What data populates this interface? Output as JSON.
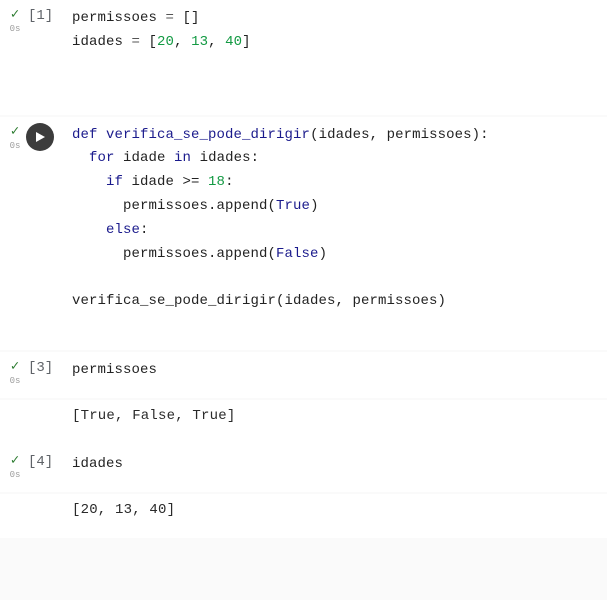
{
  "cells": [
    {
      "prompt": "[1]",
      "timing": "0s",
      "kind": "numbered",
      "lines": {
        "l0_a": "permissoes ",
        "l0_b": "=",
        "l0_c": " []",
        "l1_a": "idades ",
        "l1_b": "=",
        "l1_c": " [",
        "l1_n1": "20",
        "l1_s1": ", ",
        "l1_n2": "13",
        "l1_s2": ", ",
        "l1_n3": "40",
        "l1_d": "]"
      }
    },
    {
      "prompt": "",
      "timing": "0s",
      "kind": "run",
      "lines": {
        "l0_a": "def",
        "l0_sp": " ",
        "l0_b": "verifica_se_pode_dirigir",
        "l0_c": "(idades, permissoes):",
        "l1_a": "  ",
        "l1_b": "for",
        "l1_c": " idade ",
        "l1_d": "in",
        "l1_e": " idades:",
        "l2_a": "    ",
        "l2_b": "if",
        "l2_c": " idade >= ",
        "l2_n": "18",
        "l2_d": ":",
        "l3_a": "      permissoes.append(",
        "l3_b": "True",
        "l3_c": ")",
        "l4_a": "    ",
        "l4_b": "else",
        "l4_c": ":",
        "l5_a": "      permissoes.append(",
        "l5_b": "False",
        "l5_c": ")",
        "l6": "",
        "l7": "verifica_se_pode_dirigir(idades, permissoes)"
      }
    },
    {
      "prompt": "[3]",
      "timing": "0s",
      "kind": "numbered",
      "lines": {
        "l0": "permissoes"
      },
      "output": "[True, False, True]"
    },
    {
      "prompt": "[4]",
      "timing": "0s",
      "kind": "numbered",
      "lines": {
        "l0": "idades"
      },
      "output": "[20, 13, 40]"
    }
  ]
}
